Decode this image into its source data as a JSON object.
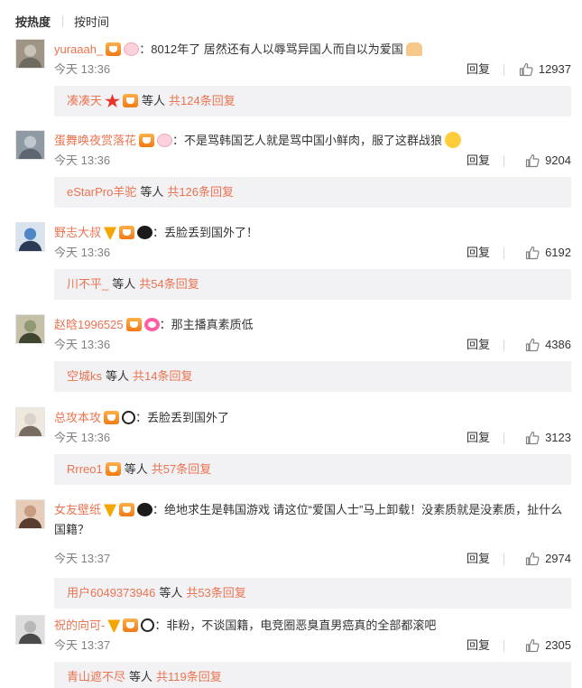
{
  "sort": {
    "hot_label": "按热度",
    "time_label": "按时间"
  },
  "common": {
    "reply_label": "回复",
    "waiting_label": "等人"
  },
  "comments": [
    {
      "username": "yuraaah_",
      "text": "：8012年了 居然还有人以辱骂异国人而自以为爱国",
      "time": "今天 13:36",
      "likes": "12937",
      "reply_user": "凑凑天",
      "reply_count": "共124条回复",
      "badges": [
        "vip",
        "pink"
      ],
      "trail_badge": "hands",
      "reply_badges": [
        "red",
        "vip"
      ],
      "avatar_icon": "avatar-icon"
    },
    {
      "username": "蛋舞唤夜赏落花",
      "text": "：不是骂韩国艺人就是骂中国小鲜肉，服了这群战狼",
      "time": "今天 13:36",
      "likes": "9204",
      "reply_user": "eStarPro羊驼",
      "reply_count": "共126条回复",
      "badges": [
        "vip",
        "pink"
      ],
      "trail_badge": "smile",
      "reply_badges": [],
      "avatar_icon": "avatar-icon"
    },
    {
      "username": "野志大叔",
      "text": "：丢脸丢到国外了！",
      "time": "今天 13:36",
      "likes": "6192",
      "reply_user": "川不平_",
      "reply_count": "共54条回复",
      "badges": [
        "v",
        "vip",
        "black"
      ],
      "trail_badge": "",
      "reply_badges": [],
      "avatar_icon": "avatar-icon"
    },
    {
      "username": "赵晗1996525",
      "text": "：那主播真素质低",
      "time": "今天 13:36",
      "likes": "4386",
      "reply_user": "空城ks",
      "reply_count": "共14条回复",
      "badges": [
        "vip",
        "donut"
      ],
      "trail_badge": "",
      "reply_badges": [],
      "avatar_icon": "avatar-icon"
    },
    {
      "username": "总攻本攻",
      "text": "：丢脸丢到国外了",
      "time": "今天 13:36",
      "likes": "3123",
      "reply_user": "Rrreo1",
      "reply_count": "共57条回复",
      "badges": [
        "vip",
        "panda"
      ],
      "trail_badge": "",
      "reply_badges": [
        "vip"
      ],
      "avatar_icon": "avatar-icon"
    },
    {
      "username": "女友壁纸",
      "text": "：绝地求生是韩国游戏 请这位“爱国人士”马上卸载！没素质就是没素质，扯什么国籍？",
      "time": "今天 13:37",
      "likes": "2974",
      "reply_user": "用户6049373946",
      "reply_count": "共53条回复",
      "badges": [
        "v",
        "vip",
        "black"
      ],
      "trail_badge": "",
      "reply_badges": [],
      "avatar_icon": "avatar-icon"
    },
    {
      "username": "祝的向可-",
      "text": "：非粉，不谈国籍，电竞圈恶臭直男癌真的全部都滚吧",
      "time": "今天 13:37",
      "likes": "2305",
      "reply_user": "青山遮不尽",
      "reply_count": "共119条回复",
      "badges": [
        "v",
        "vip",
        "panda"
      ],
      "trail_badge": "",
      "reply_badges": [],
      "avatar_icon": "avatar-icon"
    }
  ],
  "colors": {
    "link": "#eb7350",
    "reply_bg": "#f2f2f5",
    "meta": "#808080"
  }
}
